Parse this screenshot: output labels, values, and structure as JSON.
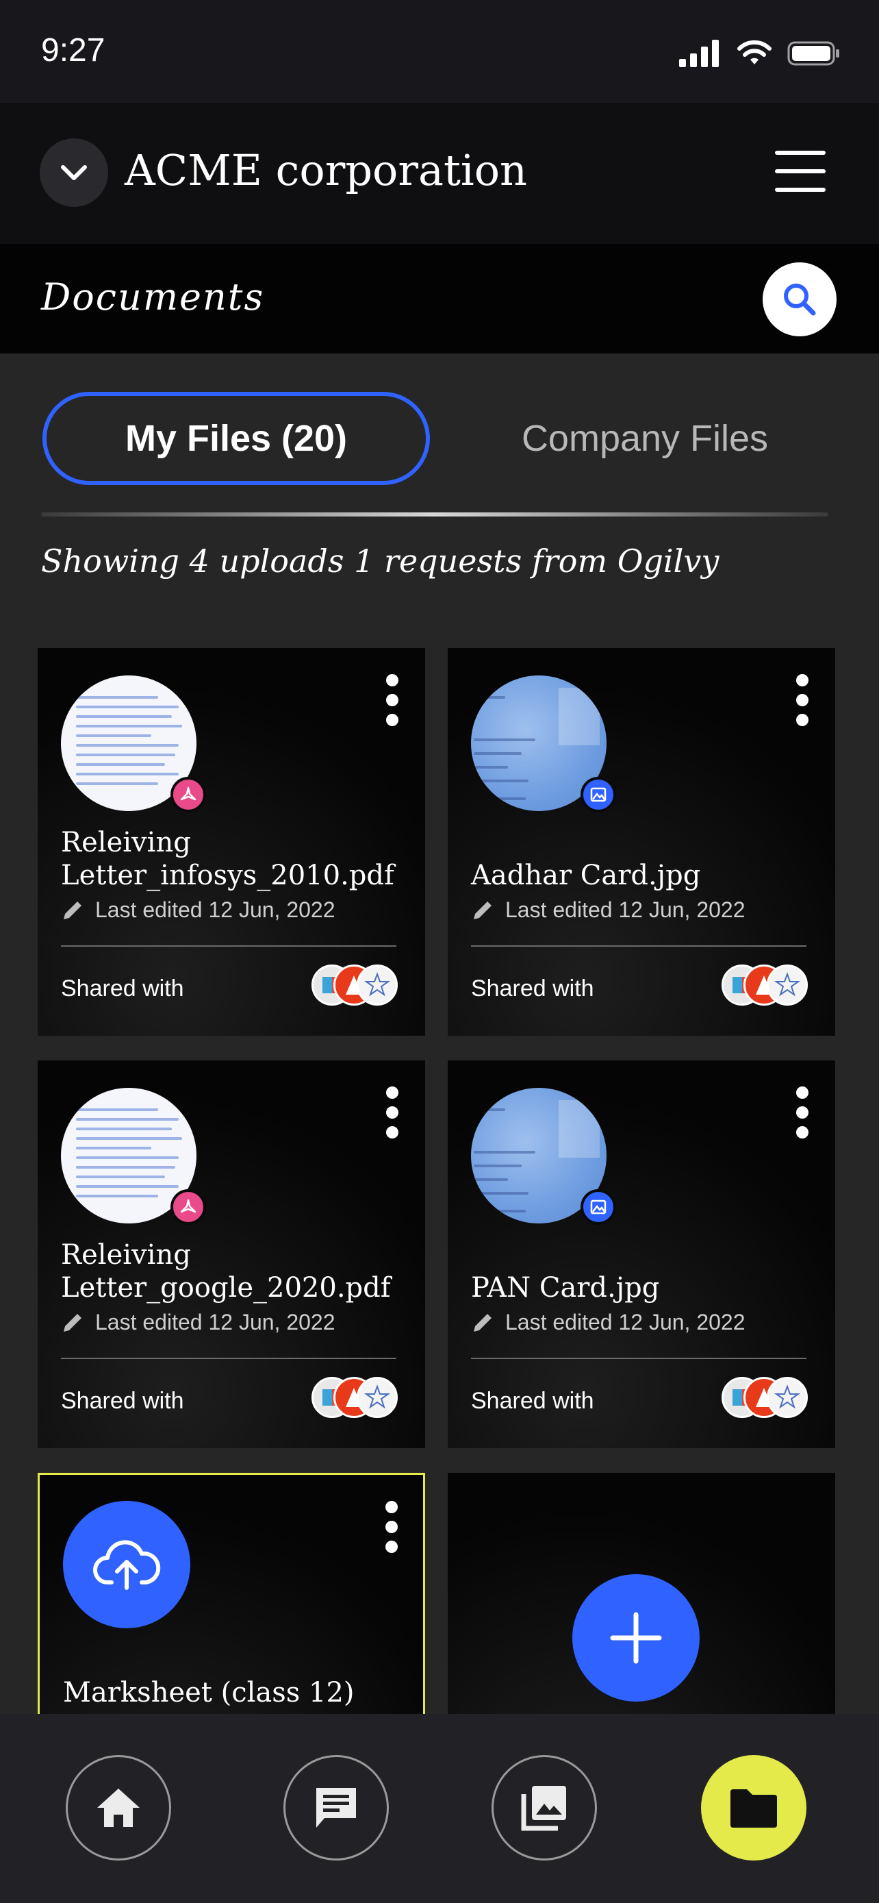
{
  "status": {
    "time": "9:27"
  },
  "header": {
    "org_name": "ACME corporation"
  },
  "section": {
    "title": "Documents"
  },
  "tabs": [
    {
      "label": "My Files (20)",
      "active": true
    },
    {
      "label": "Company Files",
      "active": false
    }
  ],
  "summary": {
    "text": "Showing 4 uploads 1 requests from Ogilvy"
  },
  "files": [
    {
      "name": "Releiving Letter_infosys_2010.pdf",
      "type": "pdf",
      "edited": "Last edited 12 Jun, 2022",
      "shared_label": "Shared with"
    },
    {
      "name": "Aadhar Card.jpg",
      "type": "image",
      "edited": "Last edited 12 Jun, 2022",
      "shared_label": "Shared with"
    },
    {
      "name": "Releiving Letter_google_2020.pdf",
      "type": "pdf",
      "edited": "Last edited 12 Jun, 2022",
      "shared_label": "Shared with"
    },
    {
      "name": "PAN Card.jpg",
      "type": "image",
      "edited": "Last edited 12 Jun, 2022",
      "shared_label": "Shared with"
    }
  ],
  "request": {
    "name": "Marksheet (class 12)"
  },
  "colors": {
    "accent": "#2f62ff",
    "highlight": "#e4ea4a",
    "pdf_badge": "#e84a8a"
  },
  "icons": [
    "chevron-down-icon",
    "menu-icon",
    "search-icon",
    "pdf-icon",
    "image-icon",
    "pencil-icon",
    "upload-cloud-icon",
    "plus-icon",
    "home-icon",
    "chat-icon",
    "gallery-icon",
    "folder-icon"
  ]
}
